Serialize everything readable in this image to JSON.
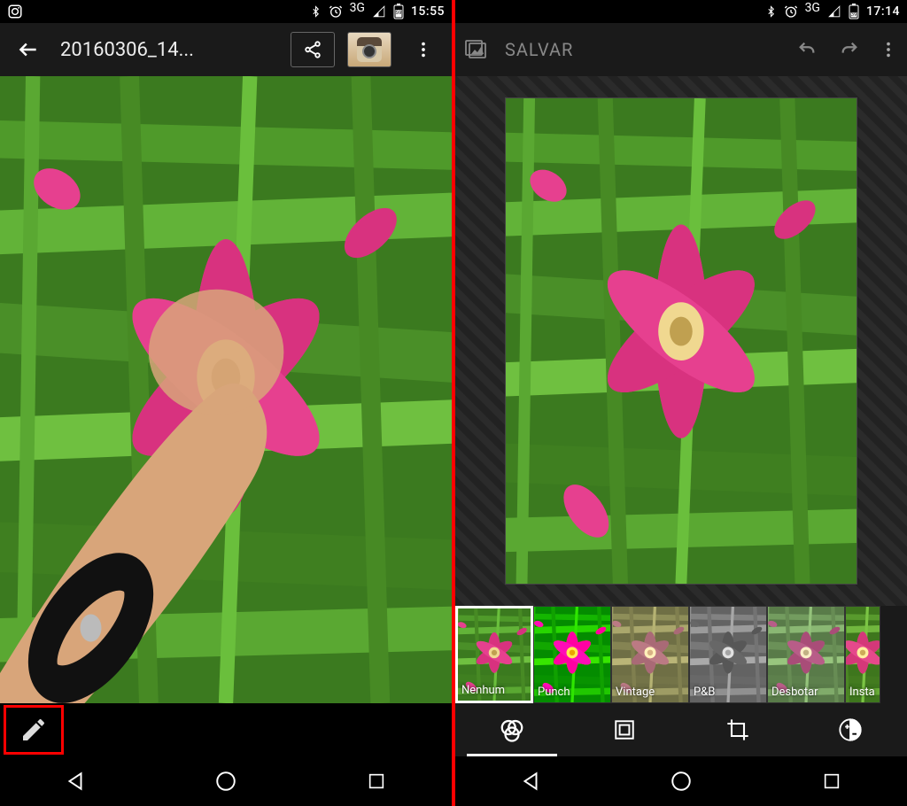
{
  "left": {
    "status": {
      "time": "15:55",
      "network": "3G",
      "battery": "59"
    },
    "actionbar": {
      "title": "20160306_14..."
    }
  },
  "right": {
    "status": {
      "time": "17:14",
      "network": "3G",
      "battery": "39"
    },
    "actionbar": {
      "save_label": "SALVAR"
    },
    "filters": [
      {
        "label": "Nenhum"
      },
      {
        "label": "Punch"
      },
      {
        "label": "Vintage"
      },
      {
        "label": "P&B"
      },
      {
        "label": "Desbotar"
      },
      {
        "label": "Insta"
      }
    ]
  }
}
